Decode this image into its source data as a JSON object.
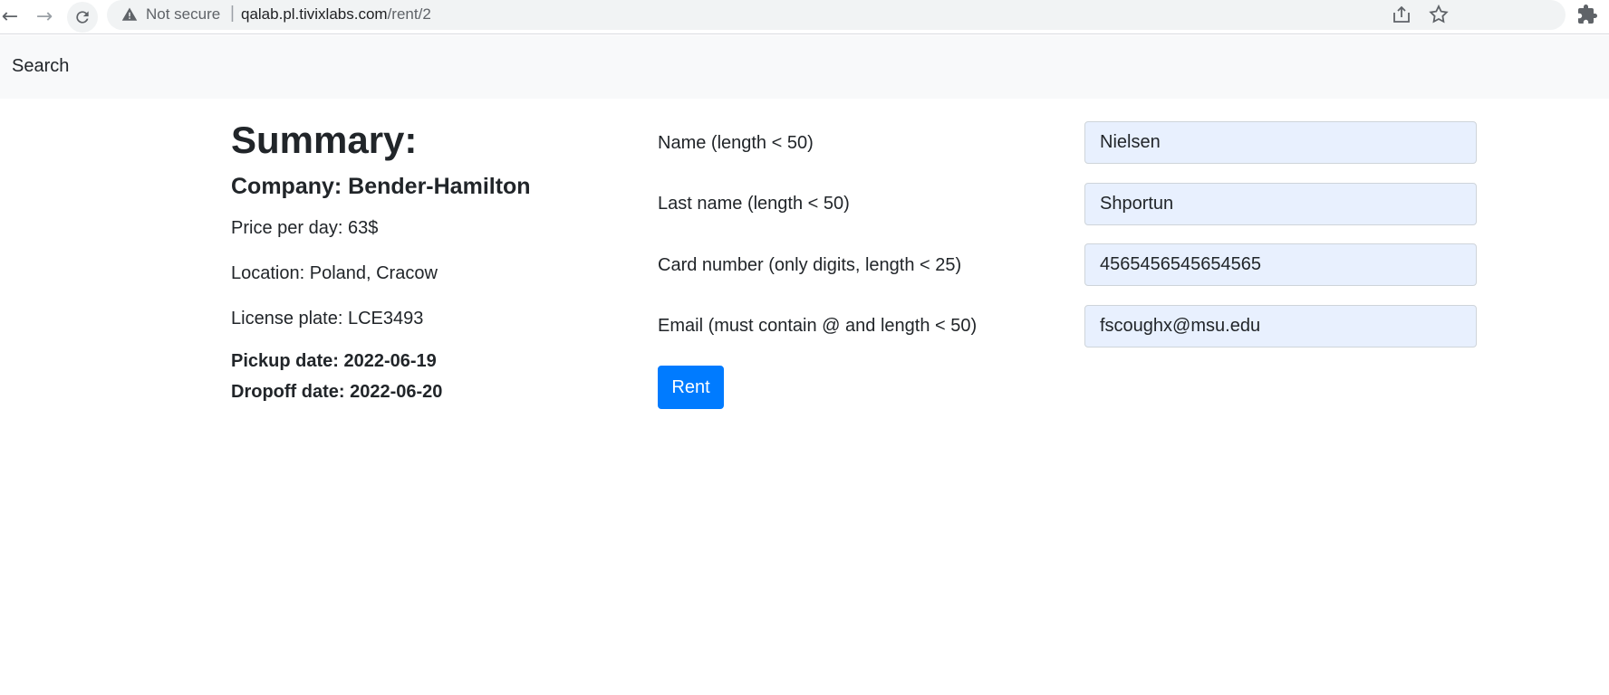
{
  "browser": {
    "security_label": "Not secure",
    "url_host": "qalab.pl.tivixlabs.com",
    "url_path": "/rent/2",
    "icons": [
      "back-arrow-icon",
      "forward-arrow-icon",
      "reload-icon",
      "warning-icon",
      "share-icon",
      "star-icon",
      "extensions-icon"
    ]
  },
  "navbar": {
    "search_label": "Search"
  },
  "summary": {
    "title": "Summary:",
    "company": "Company: Bender-Hamilton",
    "price": "Price per day: 63$",
    "location": "Location: Poland, Cracow",
    "license_plate": "License plate: LCE3493",
    "pickup_date": "Pickup date: 2022-06-19",
    "dropoff_date": "Dropoff date: 2022-06-20"
  },
  "form": {
    "name_label": "Name (length < 50)",
    "name_value": "Nielsen",
    "last_name_label": "Last name (length < 50)",
    "last_name_value": "Shportun",
    "card_label": "Card number (only digits, length < 25)",
    "card_value": "4565456545654565",
    "email_label": "Email (must contain @ and length < 50)",
    "email_value": "fscoughx@msu.edu",
    "submit_label": "Rent"
  },
  "colors": {
    "primary": "#007bff",
    "autofill_bg": "#e8f0fe",
    "navbar_bg": "#f8f9fa"
  }
}
